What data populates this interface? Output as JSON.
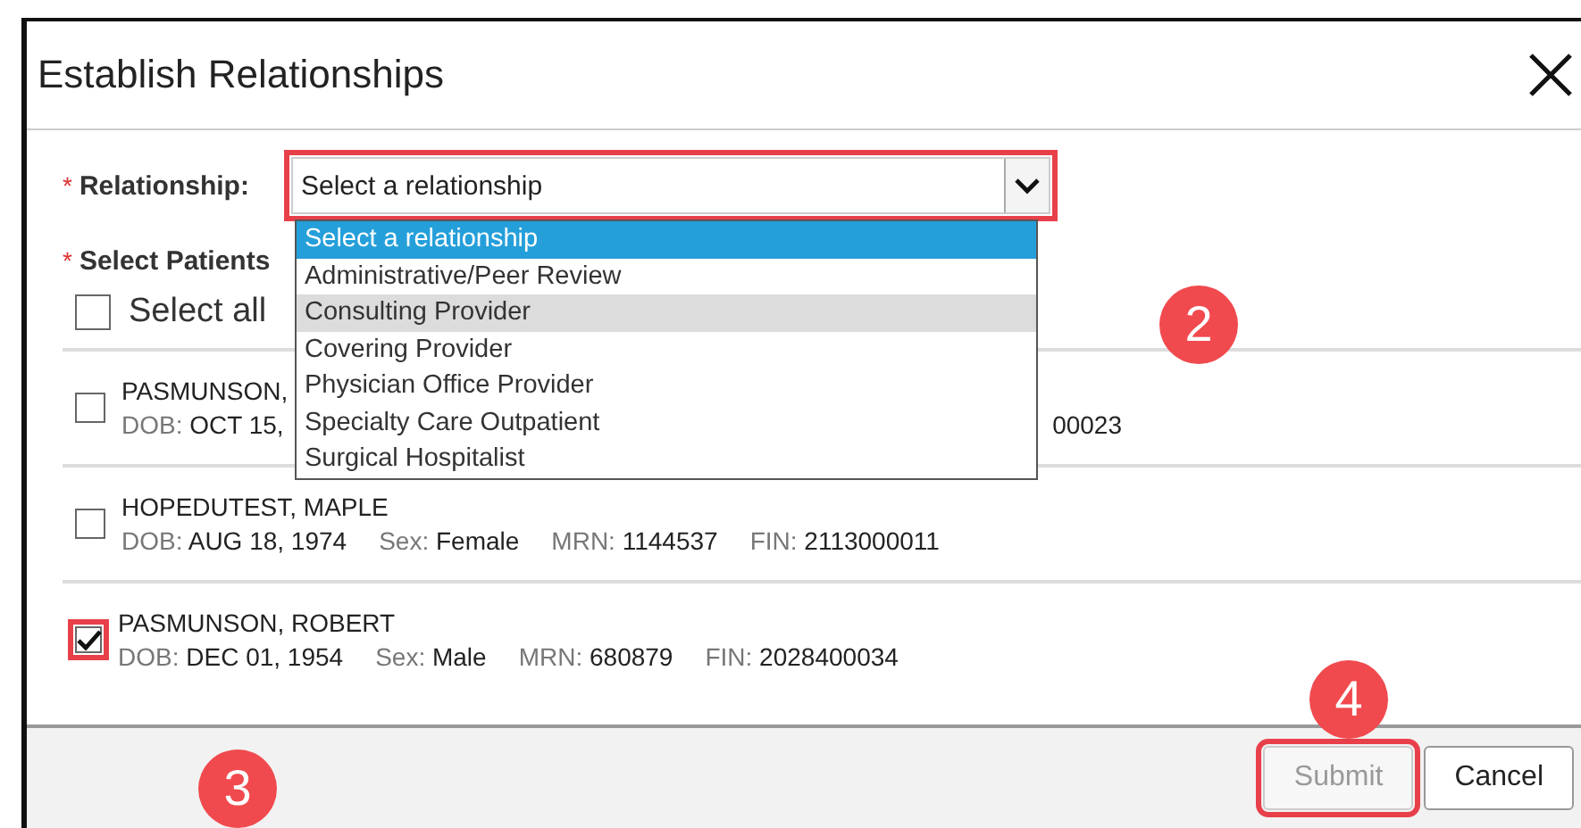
{
  "window": {
    "title": "Establish Relationships"
  },
  "relationship": {
    "required_mark": "*",
    "label": "Relationship:",
    "value": "Select a relationship",
    "highlighted": true,
    "expanded": true,
    "options": [
      {
        "label": "Select a relationship",
        "selected": true,
        "hovered": false
      },
      {
        "label": "Administrative/Peer Review",
        "selected": false,
        "hovered": false
      },
      {
        "label": "Consulting Provider",
        "selected": false,
        "hovered": true
      },
      {
        "label": "Covering Provider",
        "selected": false,
        "hovered": false
      },
      {
        "label": "Physician Office Provider",
        "selected": false,
        "hovered": false
      },
      {
        "label": "Specialty Care Outpatient",
        "selected": false,
        "hovered": false
      },
      {
        "label": "Surgical Hospitalist",
        "selected": false,
        "hovered": false
      }
    ]
  },
  "patients": {
    "required_mark": "*",
    "label": "Select Patients",
    "select_all": {
      "label": "Select all",
      "checked": false
    },
    "rows": [
      {
        "name": "PASMUNSON,",
        "checked": false,
        "highlighted": false,
        "fields": [
          {
            "label": "DOB:",
            "value": "OCT 15,"
          }
        ],
        "fragment": "00023"
      },
      {
        "name": "HOPEDUTEST, MAPLE",
        "checked": false,
        "highlighted": false,
        "fields": [
          {
            "label": "DOB:",
            "value": "AUG 18, 1974"
          },
          {
            "label": "Sex:",
            "value": "Female"
          },
          {
            "label": "MRN:",
            "value": "1144537"
          },
          {
            "label": "FIN:",
            "value": "2113000011"
          }
        ]
      },
      {
        "name": "PASMUNSON, ROBERT",
        "checked": true,
        "highlighted": true,
        "fields": [
          {
            "label": "DOB:",
            "value": "DEC 01, 1954"
          },
          {
            "label": "Sex:",
            "value": "Male"
          },
          {
            "label": "MRN:",
            "value": "680879"
          },
          {
            "label": "FIN:",
            "value": "2028400034"
          }
        ]
      }
    ]
  },
  "buttons": [
    {
      "label": "Submit",
      "disabled": true,
      "highlighted": true
    },
    {
      "label": "Cancel",
      "disabled": false,
      "highlighted": false
    }
  ],
  "annotations": [
    {
      "label": "2"
    },
    {
      "label": "3"
    },
    {
      "label": "4"
    }
  ]
}
